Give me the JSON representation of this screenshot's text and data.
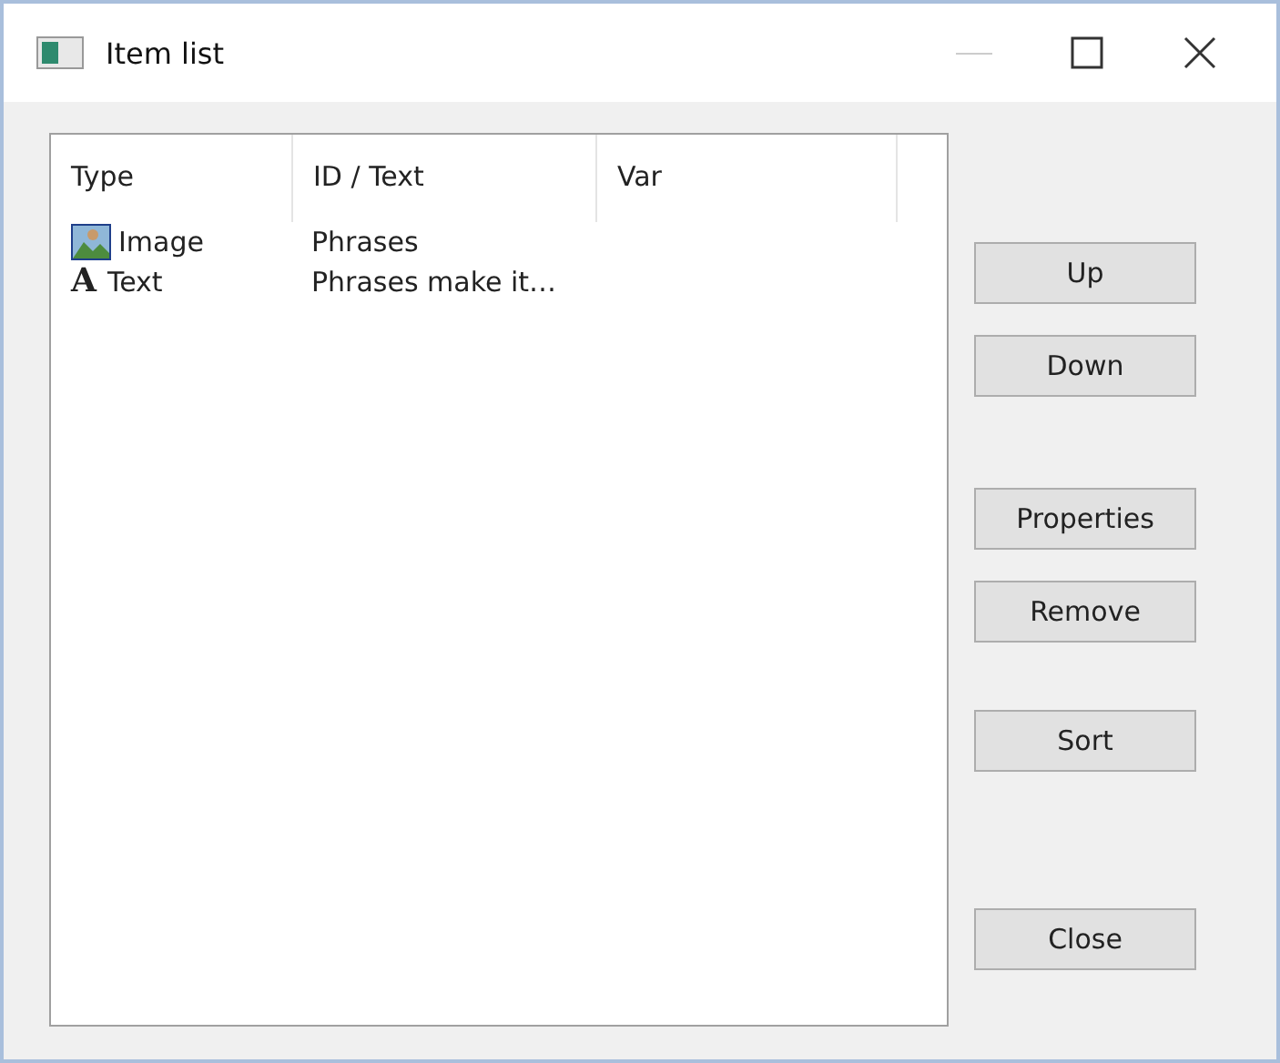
{
  "window": {
    "title": "Item list"
  },
  "table": {
    "columns": [
      "Type",
      "ID / Text",
      "Var"
    ],
    "rows": [
      {
        "kind": "image",
        "type": "Image",
        "id_text": "Phrases"
      },
      {
        "kind": "text",
        "glyph": "A",
        "type": "Text",
        "id_text": "Phrases make it…"
      }
    ]
  },
  "button_groups": [
    [
      "Up",
      "Down"
    ],
    [
      "Properties",
      "Remove"
    ],
    [
      "Sort"
    ],
    [
      "Close"
    ]
  ]
}
